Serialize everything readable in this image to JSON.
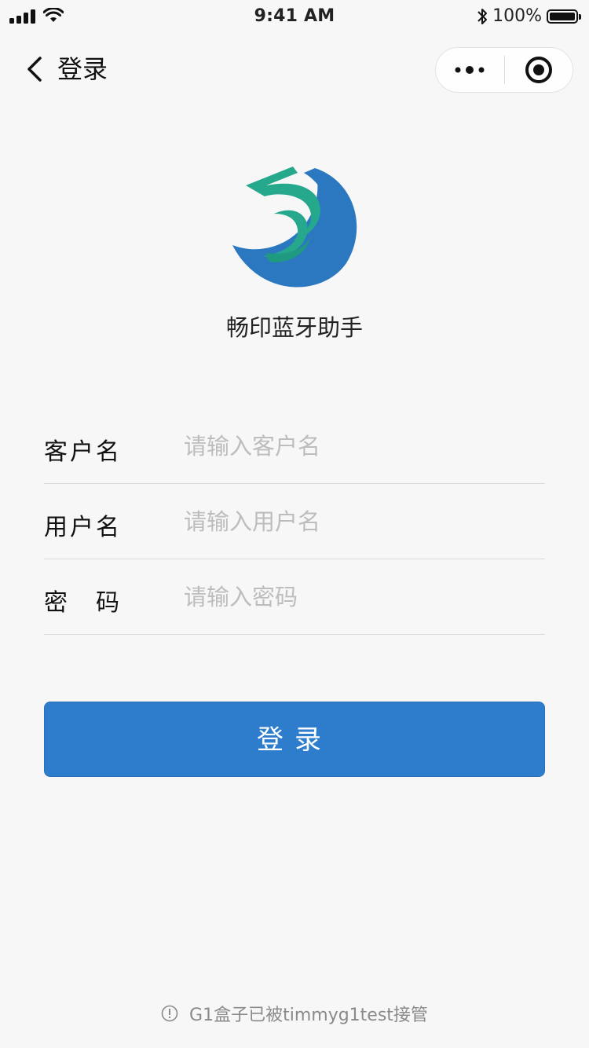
{
  "status_bar": {
    "time": "9:41 AM",
    "battery": "100%",
    "icons": [
      "signal-icon",
      "wifi-icon",
      "bluetooth-icon",
      "battery-icon"
    ]
  },
  "nav": {
    "title": "登录",
    "back_icon": "chevron-left-icon",
    "more_icon": "more-dots-icon",
    "close_icon": "target-circle-icon"
  },
  "app": {
    "name": "畅印蓝牙助手",
    "logo_colors": {
      "blue": "#2b78c0",
      "green": "#25a88c"
    }
  },
  "form": {
    "fields": [
      {
        "label": "客户名",
        "placeholder": "请输入客户名",
        "value": ""
      },
      {
        "label": "用户名",
        "placeholder": "请输入用户名",
        "value": ""
      },
      {
        "label": "密　码",
        "placeholder": "请输入密码",
        "value": ""
      }
    ]
  },
  "login_button": {
    "label": "登录",
    "color": "#2e7dcc"
  },
  "footer": {
    "icon": "info-circle-icon",
    "text": "G1盒子已被timmyg1test接管"
  }
}
